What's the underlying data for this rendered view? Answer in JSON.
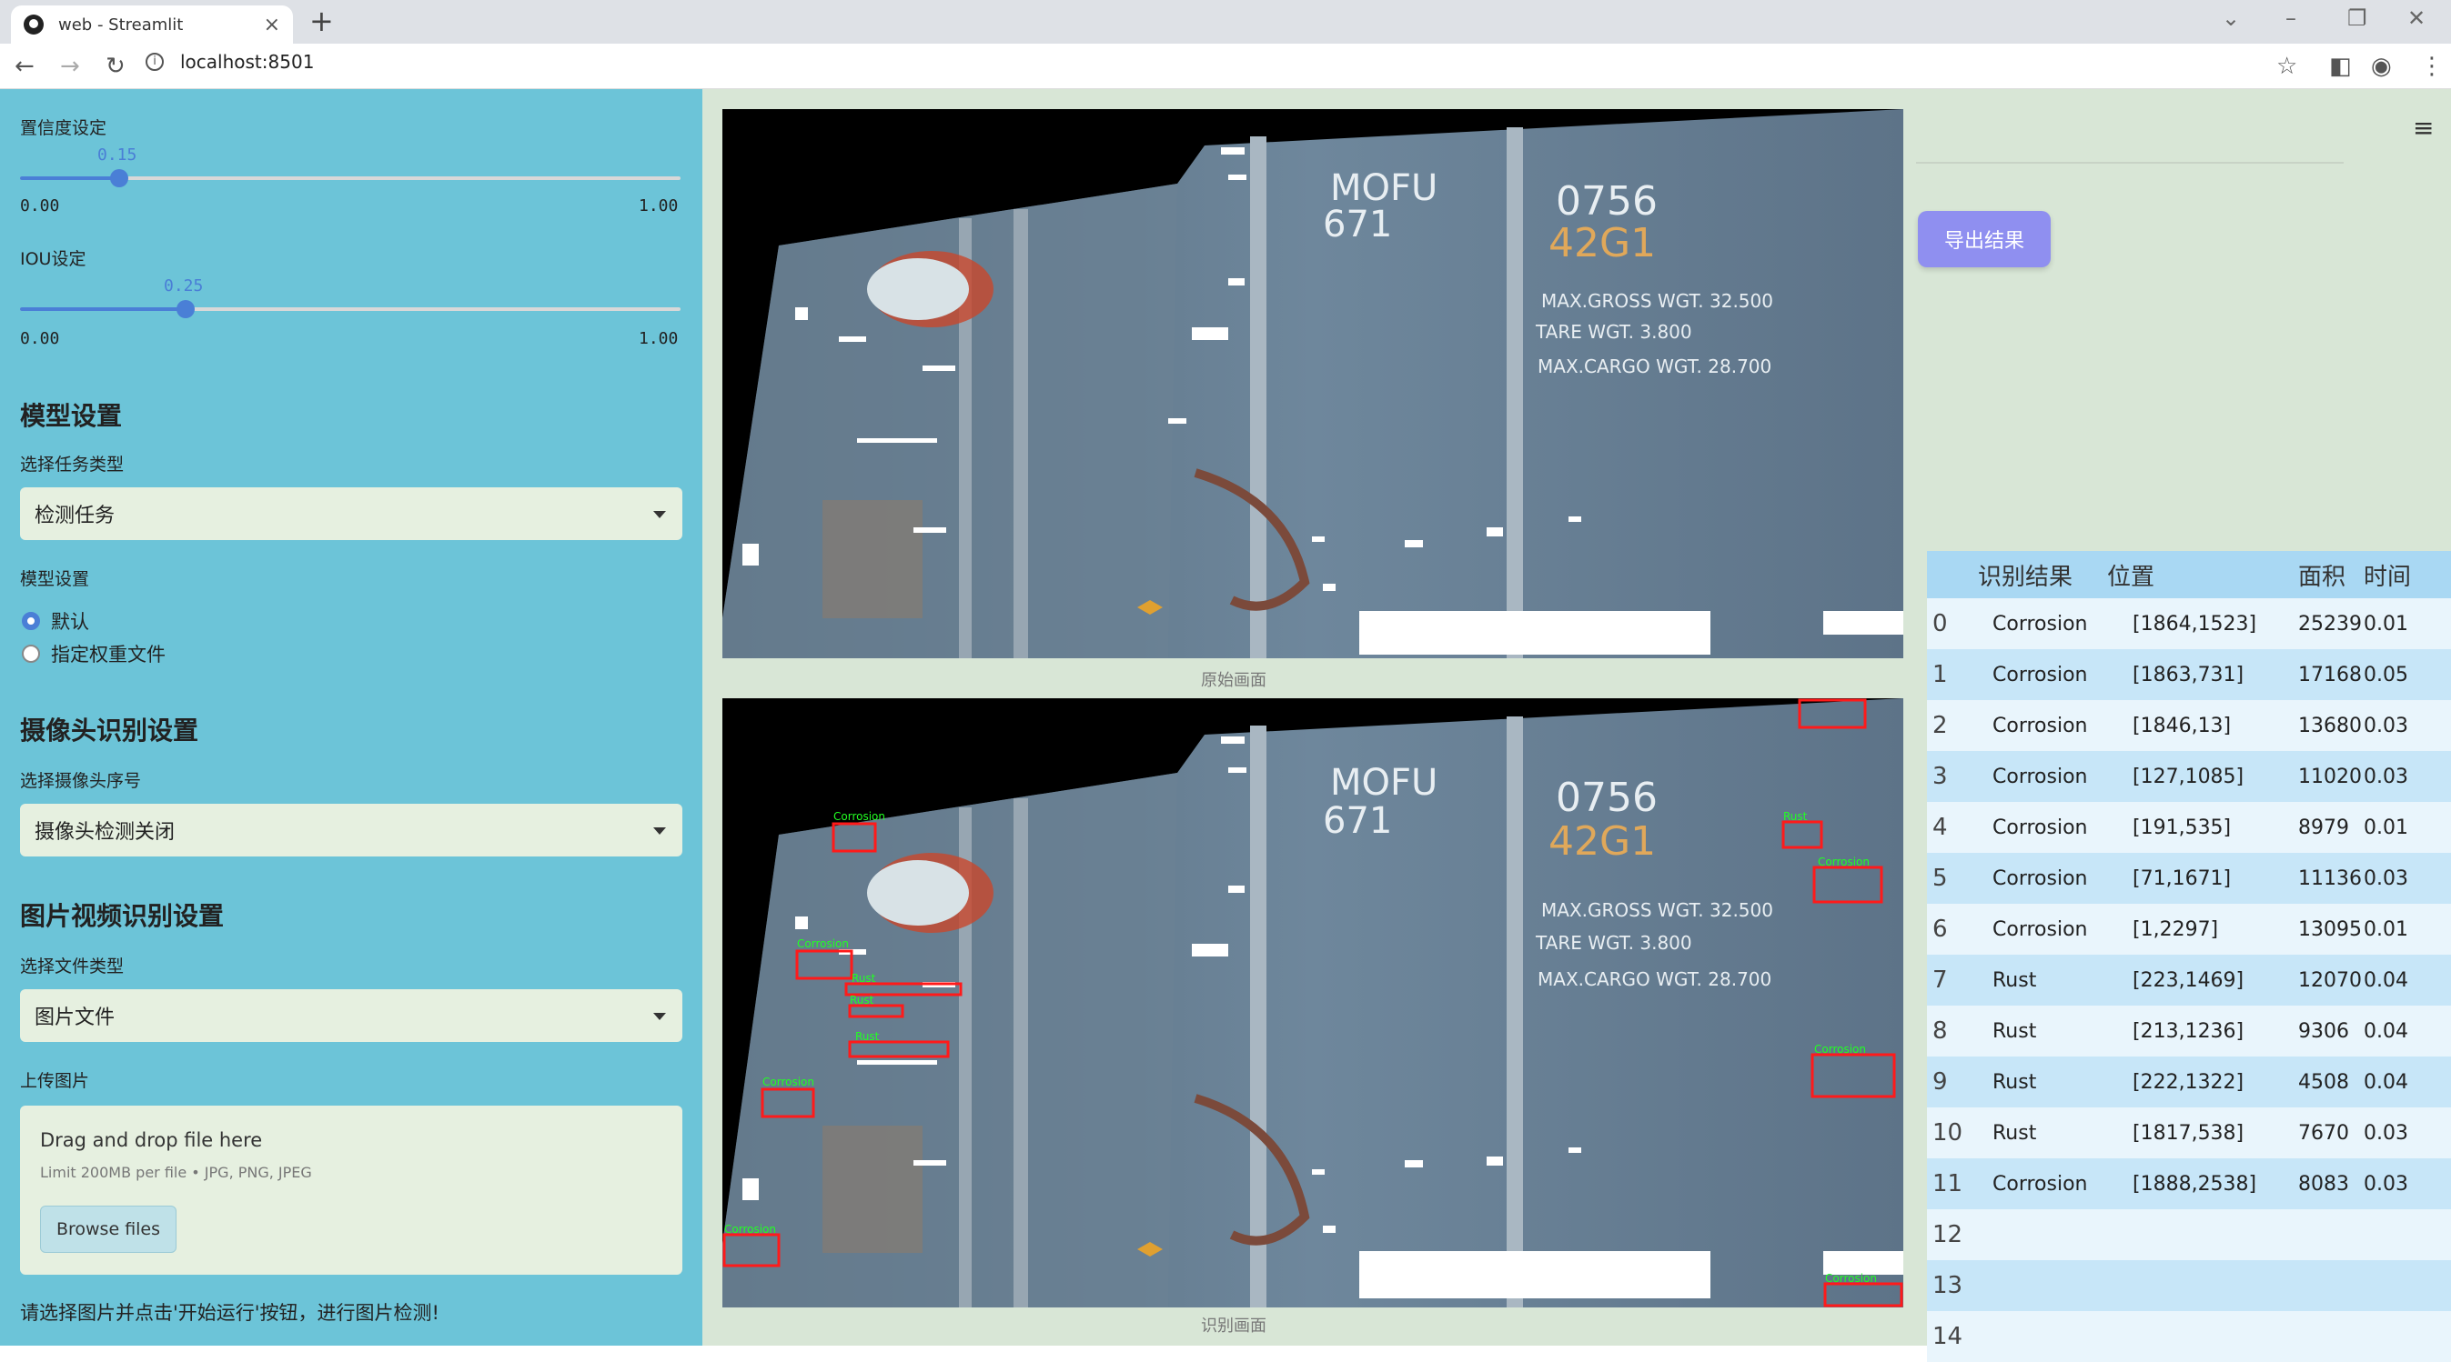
{
  "browser": {
    "tab_title": "web - Streamlit",
    "tab_close": "×",
    "new_tab": "+",
    "url": "localhost:8501",
    "url_info": "i"
  },
  "sidebar": {
    "conf_label": "置信度设定",
    "conf_value": "0.15",
    "conf_value_num": 0.15,
    "conf_min": "0.00",
    "conf_max": "1.00",
    "iou_label": "IOU设定",
    "iou_value": "0.25",
    "iou_value_num": 0.25,
    "iou_min": "0.00",
    "iou_max": "1.00",
    "model_header": "模型设置",
    "task_label": "选择任务类型",
    "task_value": "检测任务",
    "model_label": "模型设置",
    "radio_default": "默认",
    "radio_weights": "指定权重文件",
    "camera_header": "摄像头识别设置",
    "camera_label": "选择摄像头序号",
    "camera_value": "摄像头检测关闭",
    "media_header": "图片视频识别设置",
    "filetype_label": "选择文件类型",
    "filetype_value": "图片文件",
    "upload_label": "上传图片",
    "upload_drag": "Drag and drop file here",
    "upload_limit": "Limit 200MB per file • JPG, PNG, JPEG",
    "upload_button": "Browse files",
    "footer_hint": "请选择图片并点击'开始运行'按钮，进行图片检测!"
  },
  "main": {
    "caption_original": "原始画面",
    "caption_result": "识别画面",
    "export_button": "导出结果",
    "container_text": {
      "line1": "MOFU",
      "line2": "671",
      "number": "0756",
      "code": "42G1",
      "maxgross": "MAX.GROSS WGT. 32.500",
      "tare": "TARE WGT. 3.800",
      "maxcargo": "MAX.CARGO WGT. 28.700"
    },
    "labels": {
      "corrosion": "Corrosion",
      "rust": "Rust"
    }
  },
  "table": {
    "headers": {
      "result": "识别结果",
      "position": "位置",
      "area": "面积",
      "time": "时间"
    },
    "rows": [
      {
        "idx": "0",
        "result": "Corrosion",
        "position": "[1864,1523]",
        "area": "25239",
        "time": "0.01"
      },
      {
        "idx": "1",
        "result": "Corrosion",
        "position": "[1863,731]",
        "area": "17168",
        "time": "0.05"
      },
      {
        "idx": "2",
        "result": "Corrosion",
        "position": "[1846,13]",
        "area": "13680",
        "time": "0.03"
      },
      {
        "idx": "3",
        "result": "Corrosion",
        "position": "[127,1085]",
        "area": "11020",
        "time": "0.03"
      },
      {
        "idx": "4",
        "result": "Corrosion",
        "position": "[191,535]",
        "area": "8979",
        "time": "0.01"
      },
      {
        "idx": "5",
        "result": "Corrosion",
        "position": "[71,1671]",
        "area": "11136",
        "time": "0.03"
      },
      {
        "idx": "6",
        "result": "Corrosion",
        "position": "[1,2297]",
        "area": "13095",
        "time": "0.01"
      },
      {
        "idx": "7",
        "result": "Rust",
        "position": "[223,1469]",
        "area": "12070",
        "time": "0.04"
      },
      {
        "idx": "8",
        "result": "Rust",
        "position": "[213,1236]",
        "area": "9306",
        "time": "0.04"
      },
      {
        "idx": "9",
        "result": "Rust",
        "position": "[222,1322]",
        "area": "4508",
        "time": "0.04"
      },
      {
        "idx": "10",
        "result": "Rust",
        "position": "[1817,538]",
        "area": "7670",
        "time": "0.03"
      },
      {
        "idx": "11",
        "result": "Corrosion",
        "position": "[1888,2538]",
        "area": "8083",
        "time": "0.03"
      },
      {
        "idx": "12",
        "result": "",
        "position": "",
        "area": "",
        "time": ""
      },
      {
        "idx": "13",
        "result": "",
        "position": "",
        "area": "",
        "time": ""
      },
      {
        "idx": "14",
        "result": "",
        "position": "",
        "area": "",
        "time": ""
      }
    ]
  },
  "colors": {
    "sidebar_bg": "#6cc4d8",
    "main_bg": "#d8e6d6",
    "accent": "#4a7fd6",
    "export_btn": "#8f8ff0",
    "box_red": "#ff1a1a",
    "label_green": "#22ff22"
  }
}
